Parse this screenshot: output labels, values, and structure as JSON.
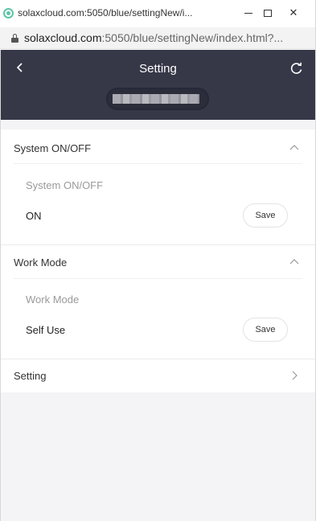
{
  "window": {
    "title": "solaxcloud.com:5050/blue/settingNew/i...",
    "minimize_label": "",
    "maximize_label": "",
    "close_label": "✕"
  },
  "urlbar": {
    "host": "solaxcloud.com",
    "rest": ":5050/blue/settingNew/index.html?..."
  },
  "header": {
    "title": "Setting"
  },
  "sections": {
    "system": {
      "title": "System ON/OFF",
      "sub_label": "System ON/OFF",
      "value": "ON",
      "save_label": "Save"
    },
    "work_mode": {
      "title": "Work Mode",
      "sub_label": "Work Mode",
      "value": "Self Use",
      "save_label": "Save"
    },
    "setting": {
      "title": "Setting"
    }
  },
  "colors": {
    "header_bg": "#363848",
    "page_bg": "#f4f4f6",
    "favicon": "#5cc6a7"
  },
  "icons": {
    "favicon": "solax-favicon-icon",
    "lock": "lock-icon",
    "back": "chevron-left-icon",
    "refresh": "refresh-icon",
    "collapse": "chevron-up-icon",
    "expand": "chevron-right-icon"
  }
}
